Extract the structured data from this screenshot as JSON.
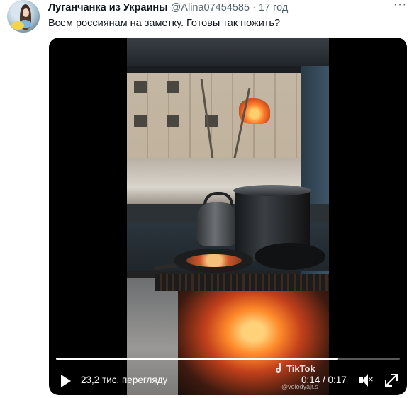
{
  "tweet": {
    "author_name": "Луганчанка из Украины",
    "author_handle": "@Alina07454585",
    "separator": "·",
    "time": "17 год",
    "text": "Всем россиянам на заметку. Готовы так пожить?",
    "more_icon": "more-horizontal-icon"
  },
  "video": {
    "views_label": "23,2 тис. переглядy",
    "current_time": "0:14",
    "duration": "0:17",
    "timecode": "0:14 / 0:17",
    "progress": 0.82,
    "watermark": "TikTok",
    "watermark_handle": "@volodyajr.s",
    "icons": {
      "play": "play-icon",
      "mute": "volume-muted-icon",
      "fullscreen": "fullscreen-icon"
    }
  }
}
